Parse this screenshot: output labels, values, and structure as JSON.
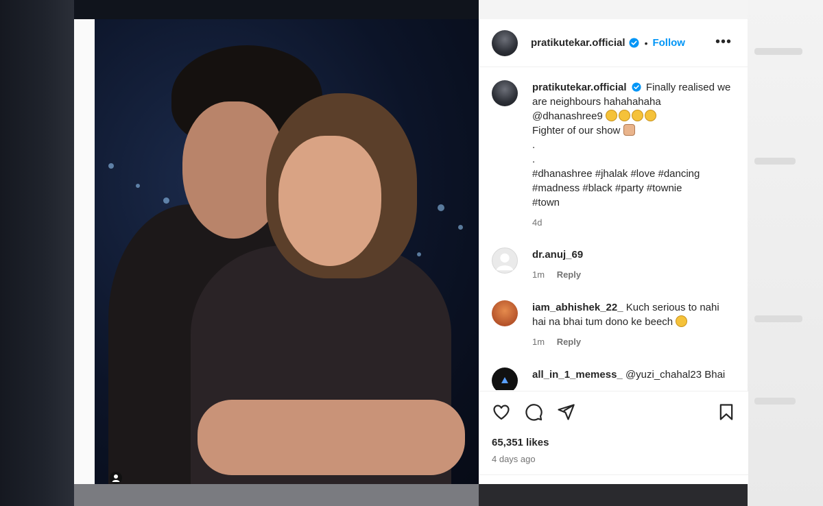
{
  "post": {
    "username": "pratikutekar.official",
    "follow_label": "Follow",
    "separator": "•",
    "more_label": "•••"
  },
  "caption": {
    "username": "pratikutekar.official",
    "line1": "Finally realised we are neighbours hahahahaha",
    "mention": "@dhanashree9",
    "line2": "Fighter of our show",
    "dot1": ".",
    "dot2": ".",
    "hashtags1": "#dhanashree #jhalak #love #dancing",
    "hashtags2": "#madness #black #party #townie",
    "hashtags3": "#town",
    "time": "4d"
  },
  "comments": [
    {
      "username": "dr.anuj_69",
      "text": "",
      "time": "1m",
      "reply": "Reply"
    },
    {
      "username": "iam_abhishek_22_",
      "text": "Kuch serious to nahi hai na bhai tum dono ke beech",
      "time": "1m",
      "reply": "Reply"
    },
    {
      "username": "all_in_1_memess_",
      "text": "@yuzi_chahal23 Bhai",
      "time": "",
      "reply": ""
    }
  ],
  "footer": {
    "likes": "65,351 likes",
    "posted": "4 days ago"
  },
  "colors": {
    "accent": "#0095f6",
    "text": "#262626",
    "muted": "#737373"
  },
  "icons": [
    "verified-badge-icon",
    "more-options-icon",
    "heart-icon",
    "comment-icon",
    "share-icon",
    "bookmark-icon",
    "person-tag-icon"
  ]
}
